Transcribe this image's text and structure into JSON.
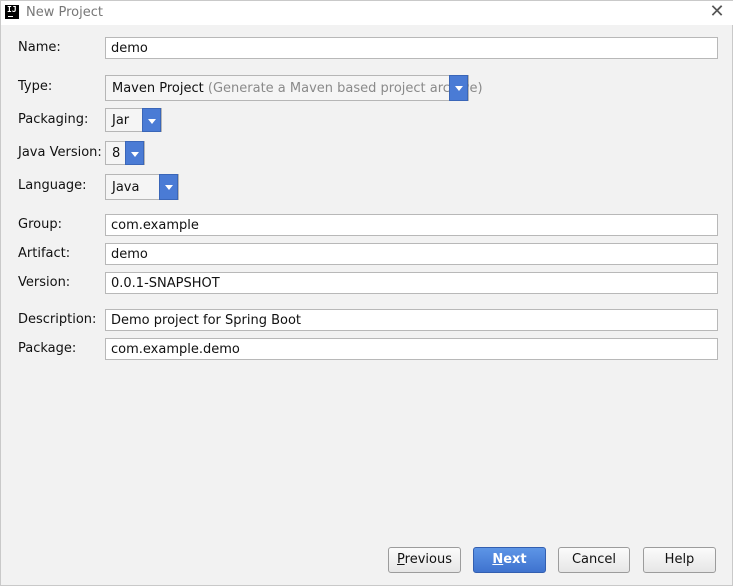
{
  "window": {
    "title": "New Project",
    "app_icon_text": "IJ"
  },
  "form": {
    "name": {
      "label": "Name:",
      "value": "demo"
    },
    "type": {
      "label": "Type:",
      "value": "Maven Project",
      "hint": "(Generate a Maven based project archive)"
    },
    "packaging": {
      "label": "Packaging:",
      "value": "Jar"
    },
    "java_version": {
      "label": "Java Version:",
      "value": "8"
    },
    "language": {
      "label": "Language:",
      "value": "Java"
    },
    "group": {
      "label": "Group:",
      "value": "com.example"
    },
    "artifact": {
      "label": "Artifact:",
      "value": "demo"
    },
    "version": {
      "label": "Version:",
      "value": "0.0.1-SNAPSHOT"
    },
    "description": {
      "label": "Description:",
      "value": "Demo project for Spring Boot"
    },
    "package": {
      "label": "Package:",
      "value": "com.example.demo"
    }
  },
  "buttons": {
    "previous": {
      "mnemonic": "P",
      "rest": "revious"
    },
    "next": {
      "mnemonic": "N",
      "rest": "ext"
    },
    "cancel": {
      "label": "Cancel"
    },
    "help": {
      "label": "Help"
    }
  },
  "colors": {
    "accent": "#4a7bd5",
    "background": "#f2f2f2"
  }
}
